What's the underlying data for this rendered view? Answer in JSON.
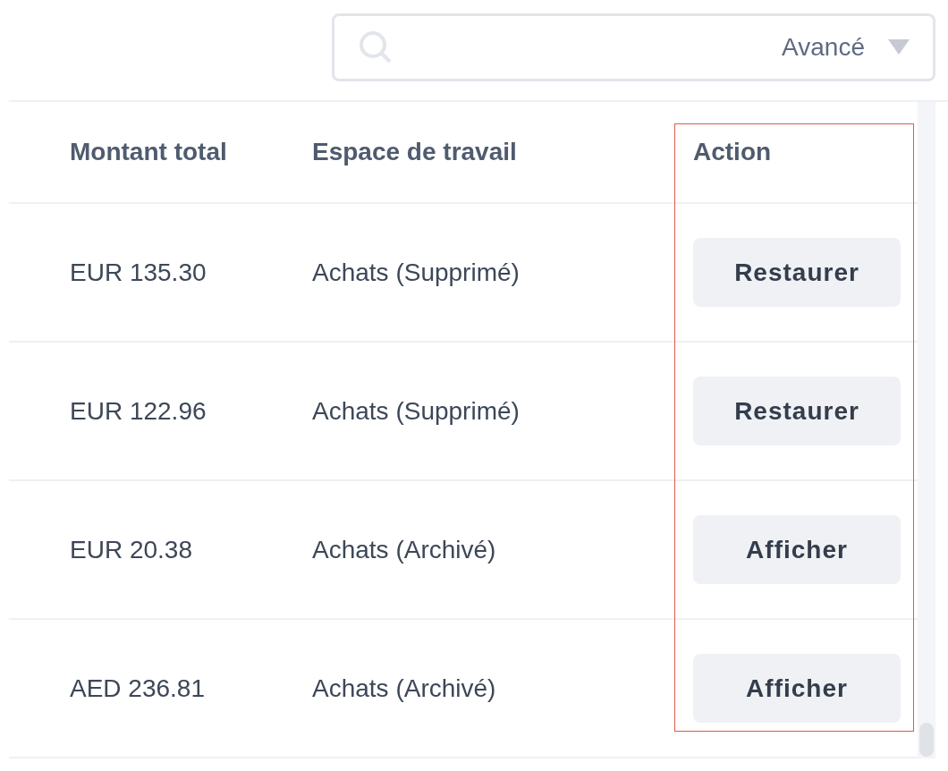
{
  "search": {
    "filter": "Avancé"
  },
  "table": {
    "columns": [
      "Montant total",
      "Espace de travail",
      "Action"
    ],
    "rows": [
      {
        "amount": "EUR 135.30",
        "workspace": "Achats (Supprimé)",
        "action": "Restaurer"
      },
      {
        "amount": "EUR 122.96",
        "workspace": "Achats (Supprimé)",
        "action": "Restaurer"
      },
      {
        "amount": "EUR 20.38",
        "workspace": "Achats (Archivé)",
        "action": "Afficher"
      },
      {
        "amount": "AED 236.81",
        "workspace": "Achats (Archivé)",
        "action": "Afficher"
      }
    ]
  }
}
